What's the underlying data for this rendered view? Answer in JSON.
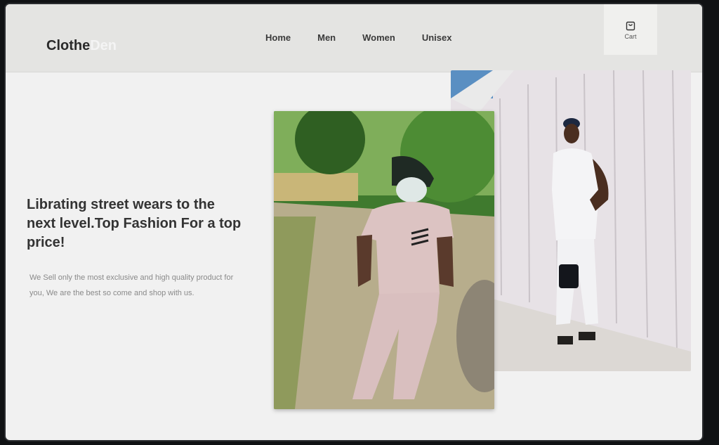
{
  "brand": {
    "part1": "Clothe",
    "part2": "Den"
  },
  "nav": {
    "items": [
      "Home",
      "Men",
      "Women",
      "Unisex"
    ]
  },
  "cart": {
    "label": "Cart",
    "icon": "cart-icon"
  },
  "hero": {
    "title": "Librating street wears to the next level.Top Fashion For a top price!",
    "description": "We Sell only the most exclusive and high quality product for you, We are the best so come and shop with us."
  },
  "colors": {
    "navbar": "#e4e4e2",
    "page": "#f1f1f1",
    "heading": "#333333",
    "muted": "#8a8a8a"
  }
}
